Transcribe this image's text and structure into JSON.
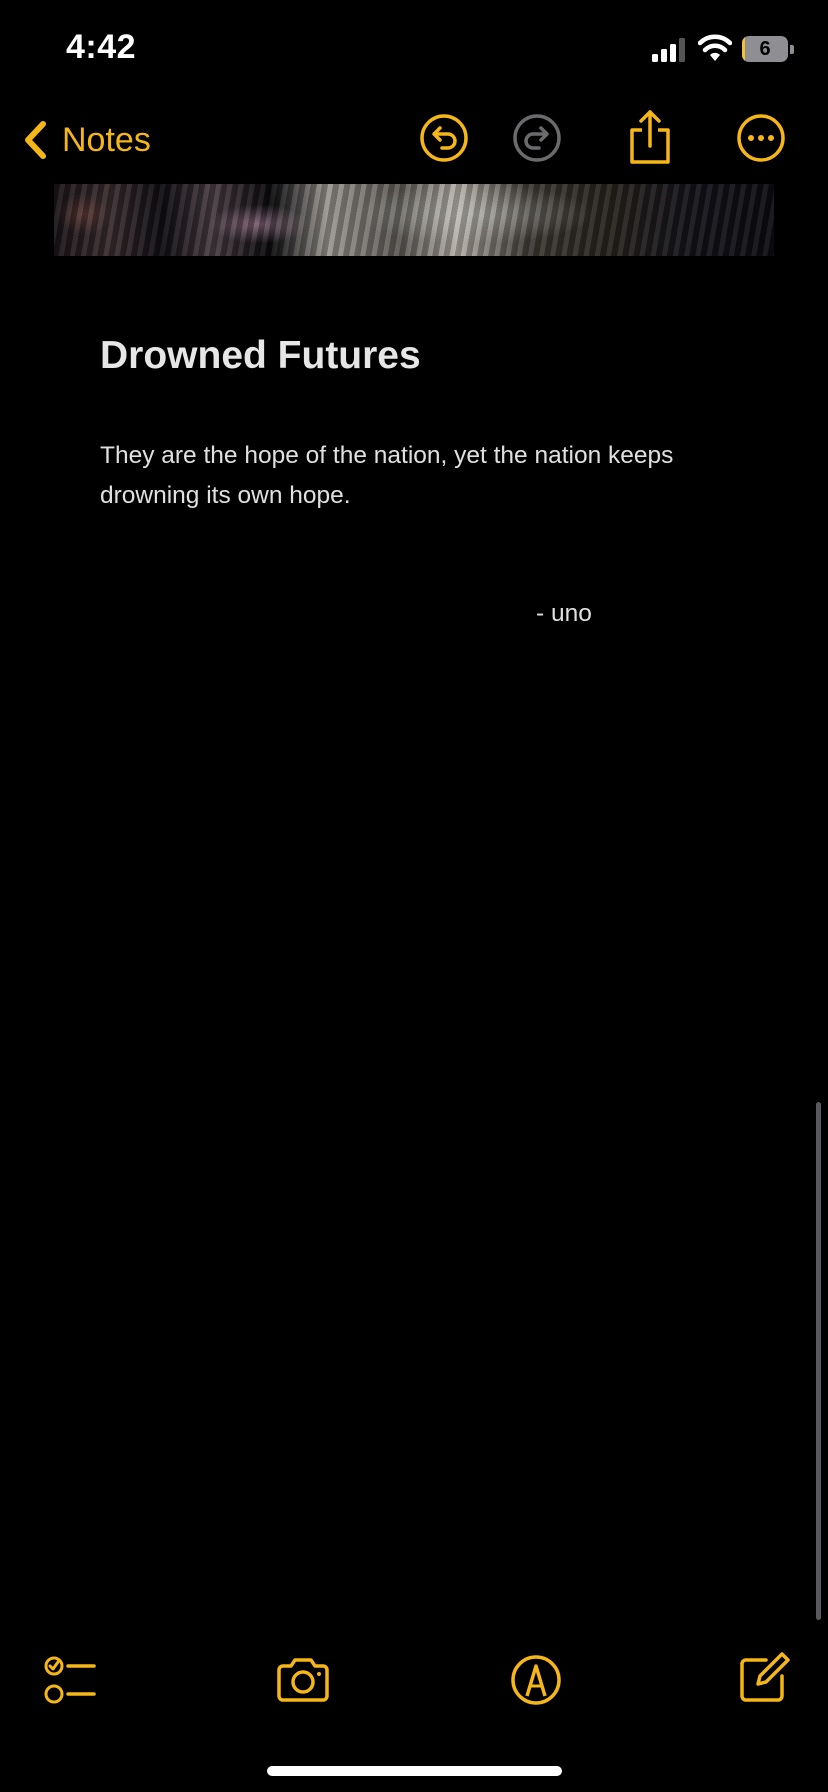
{
  "status_bar": {
    "time": "4:42",
    "battery_level": "6",
    "battery_fraction": 0.06,
    "signal_bars": 3
  },
  "nav": {
    "back_label": "Notes",
    "buttons": [
      "undo",
      "redo",
      "share",
      "more"
    ]
  },
  "note": {
    "title": "Drowned Futures",
    "body": "They are the hope of the nation, yet the nation keeps drowning its own hope.",
    "signature": "- uno"
  },
  "toolbar": {
    "items": [
      "checklist",
      "camera",
      "markup",
      "compose"
    ]
  },
  "colors": {
    "accent": "#f5b617",
    "background": "#000000",
    "text": "#e0e0e0",
    "disabled": "#6b6b6e"
  },
  "icons": {
    "back": "chevron-left-icon",
    "undo": "undo-icon",
    "redo": "redo-icon",
    "share": "share-icon",
    "more": "ellipsis-circle-icon",
    "checklist": "checklist-icon",
    "camera": "camera-icon",
    "markup": "markup-pen-icon",
    "compose": "compose-icon"
  }
}
